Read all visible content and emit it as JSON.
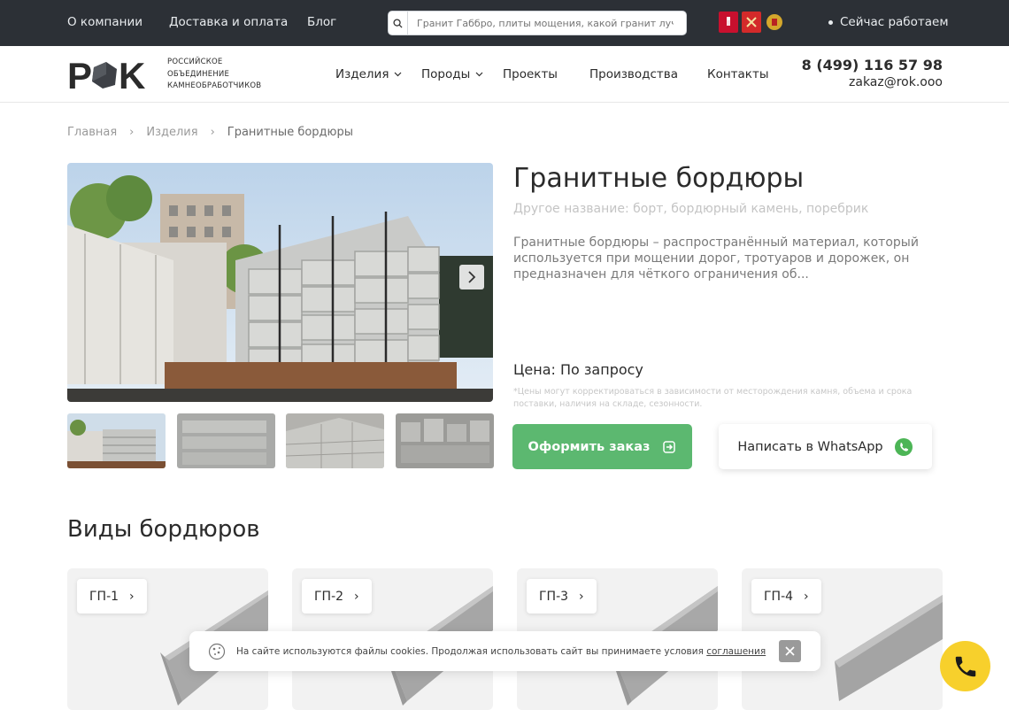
{
  "topbar": {
    "links": [
      "О компании",
      "Доставка и оплата",
      "Блог"
    ],
    "search_placeholder": "Гранит Габбро, плиты мощения, какой гранит лучше",
    "status": "Сейчас работаем",
    "flags": [
      "moscow-coat-icon",
      "spb-coat-icon",
      "russia-coat-icon"
    ]
  },
  "header": {
    "logo_text": "РОК",
    "logo_sub": [
      "РОССИЙСКОЕ",
      "ОБЪЕДИНЕНИЕ",
      "КАМНЕОБРАБОТЧИКОВ"
    ],
    "nav": [
      {
        "label": "Изделия",
        "dropdown": true
      },
      {
        "label": "Породы",
        "dropdown": true
      },
      {
        "label": "Проекты",
        "dropdown": false
      },
      {
        "label": "Производства",
        "dropdown": false
      },
      {
        "label": "Контакты",
        "dropdown": false
      }
    ],
    "phone": "8 (499) 116 57 98",
    "email": "zakaz@rok.ooo"
  },
  "breadcrumb": [
    "Главная",
    "Изделия",
    "Гранитные бордюры"
  ],
  "product": {
    "title": "Гранитные бордюры",
    "alt_names": "Другое название: борт, бордюрный камень, поребрик",
    "description": "Гранитные бордюры – распространённый материал, который используется при мощении дорог, тротуаров и дорожек, он предназначен для чёткого ограничения об...",
    "price": "Цена: По запросу",
    "price_note": "*Цены могут корректироваться в зависимости от месторождения камня, объема и срока поставки, наличия на складе, сезонности.",
    "order_button": "Оформить заказ",
    "whatsapp_button": "Написать в WhatsApp"
  },
  "section": {
    "title": "Виды бордюров",
    "cards": [
      "ГП-1",
      "ГП-2",
      "ГП-3",
      "ГП-4"
    ]
  },
  "cookie": {
    "text": "На сайте используются файлы cookies. Продолжая использовать сайт вы принимаете условия",
    "link": "соглашения"
  },
  "colors": {
    "topbar_bg": "#2c3036",
    "accent_green": "#5cb870",
    "whatsapp_green": "#4cb556",
    "call_yellow": "#f7d02c"
  }
}
